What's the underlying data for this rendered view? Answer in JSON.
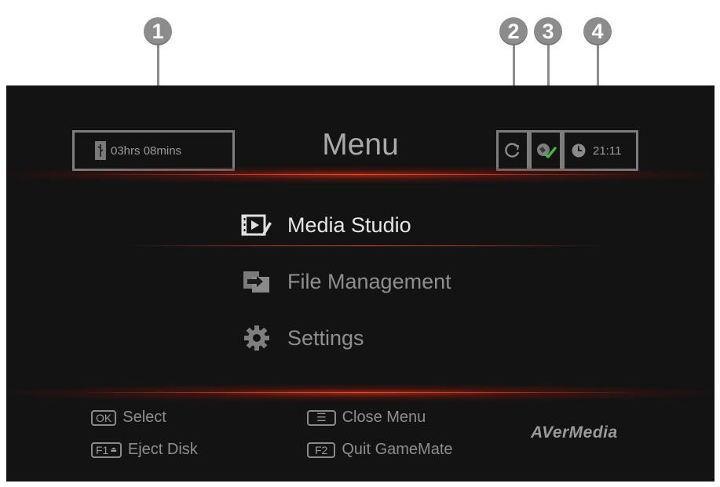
{
  "callouts": [
    "1",
    "2",
    "3",
    "4"
  ],
  "status": {
    "storage_icon": "usb-icon",
    "record_time": "03hrs 08mins",
    "sync_icon": "sync-icon",
    "network_icon": "network-connected-icon",
    "clock_icon": "clock-icon",
    "time": "21:11"
  },
  "header": {
    "title": "Menu"
  },
  "menu": {
    "items": [
      {
        "label": "Media Studio",
        "icon": "media-studio-icon",
        "state": "selected"
      },
      {
        "label": "File Management",
        "icon": "file-management-icon",
        "state": "normal"
      },
      {
        "label": "Settings",
        "icon": "gear-icon",
        "state": "normal"
      }
    ]
  },
  "footer": {
    "hints": [
      {
        "key": "OK",
        "label": "Select"
      },
      {
        "key": "F1",
        "label": "Eject Disk"
      },
      {
        "key": "☰",
        "label": "Close Menu"
      },
      {
        "key": "F2",
        "label": "Quit GameMate"
      }
    ],
    "brand": "AVerMedia"
  },
  "colors": {
    "background": "#131313",
    "accent_glow": "#c0392b",
    "text_active": "#e6e6e6",
    "text_dim": "#8f8f8f"
  }
}
